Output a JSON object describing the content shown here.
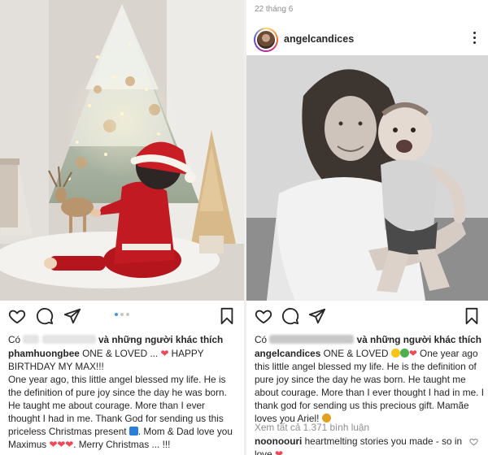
{
  "left_post": {
    "liked_by_prefix": "Có",
    "liked_by_rest": "và những người khác thích",
    "caption_user": "phamhuongbee",
    "caption_line1": "ONE & LOVED ...",
    "caption_line1b": "HAPPY BIRTHDAY MY MAX!!!",
    "caption_line2": "One year ago, this little angel blessed my life. He is the definition of pure joy since the day he was born. He taught me about courage. More than I ever thought I had in me. Thank God for sending us this priceless Christmas present",
    "caption_line3": ". Mom & Dad love you Maximus",
    "caption_line4": "Merry Christmas ... !!!"
  },
  "right_post": {
    "date": "22 tháng 6",
    "username": "angelcandices",
    "liked_by_prefix": "Có",
    "liked_by_rest": "và những người khác thích",
    "caption_user": "angelcandices",
    "caption_text1": "ONE & LOVED",
    "caption_text2": "One year ago this little angel blessed my life. He is the definition of pure joy since the day he was born. He taught me about courage. More than I ever thought I had in me. I thank god for sending us this precious gift. Mamãe loves you Ariel!",
    "view_all": "Xem tất cả 1.371 bình luận",
    "comment_user": "noonoouri",
    "comment_text": "heartmelting stories you made - so in love"
  },
  "icons": {
    "like": "heart-outline-icon",
    "comment": "speech-bubble-icon",
    "share": "paper-plane-icon",
    "save": "bookmark-icon",
    "more": "vertical-dots-icon"
  },
  "colors": {
    "heart_red": "#ed4956",
    "link_blue": "#3897f0",
    "muted": "#8e8e8e",
    "text": "#262626"
  }
}
